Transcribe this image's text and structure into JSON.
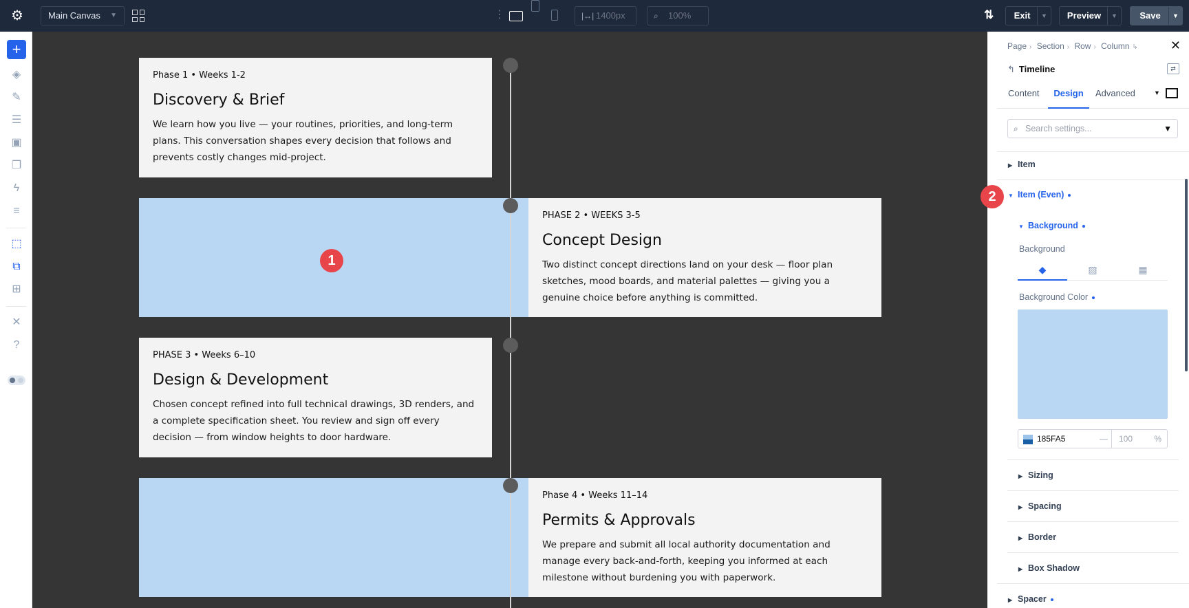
{
  "topbar": {
    "canvas_select": "Main Canvas",
    "width_value": "1400px",
    "zoom_value": "100%",
    "exit_label": "Exit",
    "preview_label": "Preview",
    "save_label": "Save"
  },
  "canvas": {
    "items": [
      {
        "meta": "Phase 1 • Weeks 1-2",
        "title": "Discovery & Brief",
        "body": "We learn how you live — your routines, priorities, and long-term plans. This conversation shapes every decision that follows and prevents costly changes mid-project."
      },
      {
        "meta": "PHASE 2 • WEEKS 3-5",
        "title": "Concept Design",
        "body": "Two distinct concept directions land on your desk — floor plan sketches, mood boards, and material palettes — giving you a genuine choice before anything is committed."
      },
      {
        "meta": "PHASE 3 • Weeks 6–10",
        "title": "Design & Development",
        "body": "Chosen concept refined into full technical drawings, 3D renders, and a complete specification sheet. You review and sign off every decision — from window heights to door hardware."
      },
      {
        "meta": "Phase 4 • Weeks 11–14",
        "title": "Permits & Approvals",
        "body": "We prepare and submit all local authority documentation and manage every back-and-forth, keeping you informed at each milestone without burdening you with paperwork."
      }
    ],
    "marker_1": "1",
    "marker_2": "2"
  },
  "panel": {
    "breadcrumb": [
      "Page",
      "Section",
      "Row",
      "Column"
    ],
    "module_title": "Timeline",
    "tabs": [
      "Content",
      "Design",
      "Advanced"
    ],
    "search_placeholder": "Search settings...",
    "groups": {
      "item": "Item",
      "item_even": "Item (Even)",
      "background": "Background",
      "sizing": "Sizing",
      "spacing": "Spacing",
      "border": "Border",
      "box_shadow": "Box Shadow",
      "spacer": "Spacer"
    },
    "background_label": "Background",
    "background_color_label": "Background Color",
    "color_hex": "185FA5",
    "opacity_dash": "—",
    "opacity_value": "100",
    "opacity_unit": "%"
  },
  "colors": {
    "item_even_bg": "#b9d6f2",
    "accent": "#2563eb",
    "marker": "#e8454a"
  }
}
